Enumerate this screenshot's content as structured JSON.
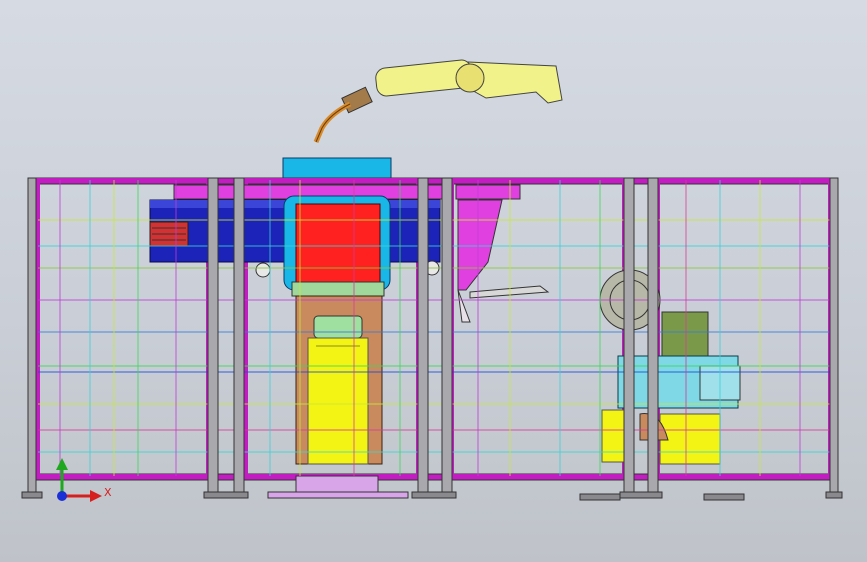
{
  "viewport": {
    "background_top": "#d6dbe3",
    "background_bottom": "#bfc3c9"
  },
  "triad": {
    "x_label": "X",
    "x_color": "#d62020",
    "y_color": "#1fa81f",
    "z_color": "#1a2fd6",
    "icon": "coordinate-triad-icon"
  },
  "colors": {
    "frame": "#c21cc2",
    "post": "#a9a9ad",
    "blue_beam": "#1c23b8",
    "red_block": "#ff2020",
    "cyan_box": "#19b6e8",
    "tan_body": "#c98a5e",
    "yellow_panel": "#f4f414",
    "teal_motor": "#7fd8e6",
    "olive": "#9aa05a",
    "robot_arm": "#f2f28a",
    "torch": "#d88a2a",
    "lilac_base": "#d8a6e8"
  }
}
